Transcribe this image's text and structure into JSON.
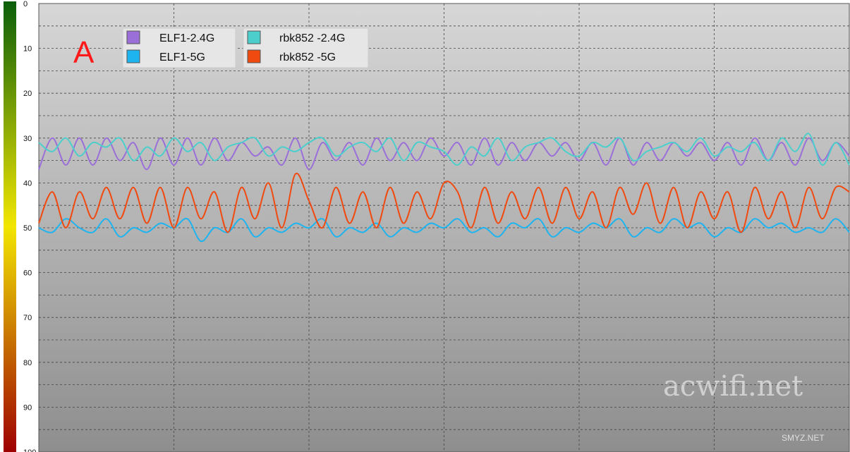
{
  "chart_data": {
    "type": "line",
    "title": "",
    "xlabel": "",
    "ylabel": "",
    "ylim": [
      0,
      100
    ],
    "y_inverted": true,
    "yticks": [
      "0",
      "10",
      "20",
      "30",
      "40",
      "50",
      "60",
      "70",
      "80",
      "90",
      "100"
    ],
    "grid": true,
    "legend_position": "top-left",
    "colorbar": {
      "top_color": "#0a5e0a",
      "middle_color": "#f2e600",
      "bottom_color": "#9e0000"
    },
    "x": [
      0,
      2,
      4,
      6,
      8,
      10,
      12,
      14,
      16,
      18,
      20,
      22,
      24,
      26,
      28,
      30,
      32,
      34,
      36,
      38,
      40,
      42,
      44,
      46,
      48,
      50,
      52,
      54,
      56,
      58,
      60,
      62,
      64,
      66,
      68,
      70,
      72,
      74,
      76,
      78,
      80,
      82,
      84,
      86,
      88,
      90,
      92,
      94,
      96,
      98,
      100,
      102,
      104,
      106,
      108,
      110,
      112,
      114,
      116,
      118,
      120
    ],
    "series": [
      {
        "name": "ELF1-2.4G",
        "color": "#9b6fd8",
        "values": [
          37,
          30,
          36,
          30,
          36,
          30,
          35,
          31,
          37,
          30,
          36,
          30,
          36,
          30,
          35,
          31,
          34,
          32,
          36,
          30,
          37,
          31,
          35,
          31,
          36,
          30,
          35,
          31,
          35,
          30,
          34,
          31,
          36,
          30,
          36,
          31,
          35,
          31,
          34,
          31,
          35,
          31,
          36,
          30,
          36,
          31,
          35,
          31,
          34,
          31,
          35,
          31,
          36,
          30,
          35,
          31,
          36,
          30,
          35,
          31,
          34
        ]
      },
      {
        "name": "ELF1-5G",
        "color": "#1eb4f0",
        "values": [
          50,
          51,
          48,
          50,
          51,
          48,
          52,
          50,
          51,
          49,
          50,
          48,
          53,
          50,
          51,
          48,
          52,
          50,
          51,
          49,
          50,
          48,
          52,
          50,
          51,
          49,
          52,
          50,
          51,
          49,
          50,
          48,
          51,
          50,
          52,
          49,
          50,
          48,
          52,
          50,
          51,
          49,
          50,
          48,
          52,
          50,
          51,
          48,
          50,
          49,
          52,
          50,
          51,
          48,
          50,
          49,
          51,
          50,
          51,
          48,
          51
        ]
      },
      {
        "name": "rbk852 -2.4G",
        "color": "#4ccfcc",
        "values": [
          31,
          33,
          30,
          34,
          31,
          32,
          30,
          35,
          32,
          34,
          30,
          33,
          31,
          35,
          32,
          31,
          30,
          34,
          32,
          33,
          31,
          30,
          34,
          32,
          31,
          33,
          30,
          35,
          31,
          32,
          33,
          36,
          32,
          34,
          30,
          35,
          32,
          31,
          30,
          33,
          34,
          31,
          32,
          30,
          35,
          33,
          32,
          31,
          33,
          30,
          34,
          32,
          33,
          31,
          35,
          30,
          33,
          29,
          36,
          31,
          36
        ]
      },
      {
        "name": "rbk852 -5G",
        "color": "#f04a10",
        "values": [
          49,
          42,
          50,
          42,
          48,
          41,
          48,
          41,
          49,
          41,
          50,
          41,
          48,
          42,
          51,
          41,
          48,
          40,
          50,
          38,
          44,
          50,
          41,
          49,
          42,
          50,
          41,
          49,
          42,
          48,
          40,
          42,
          50,
          41,
          49,
          42,
          48,
          41,
          49,
          41,
          48,
          42,
          50,
          41,
          47,
          40,
          49,
          41,
          50,
          42,
          48,
          42,
          51,
          41,
          48,
          42,
          50,
          41,
          48,
          41,
          42
        ]
      }
    ]
  },
  "annotation": {
    "label": "A"
  },
  "watermark": {
    "primary": "acwifi.net",
    "secondary": "SMYZ.NET"
  }
}
